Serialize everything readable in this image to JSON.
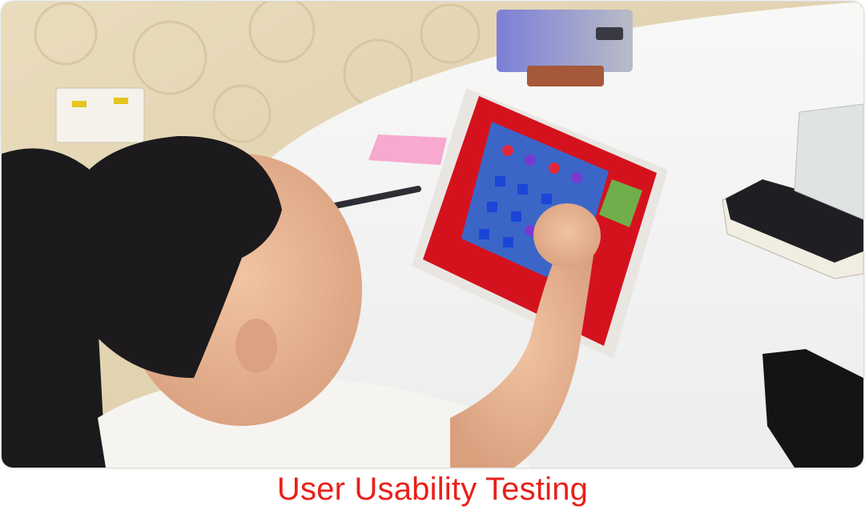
{
  "caption": {
    "text": "User Usability Testing",
    "color": "#e8201a"
  },
  "photo": {
    "icons": [
      "child-figure",
      "tablet",
      "smartphone",
      "pen",
      "sticky-note",
      "wall-socket",
      "eraser",
      "desk"
    ],
    "colors": {
      "wall": "#e5d6b4",
      "desk": "#f4f4f2",
      "tablet_case": "#d4121e",
      "game_board": "#3b66c8",
      "hair": "#1c1a1c",
      "skin": "#e9b895",
      "shirt": "#f6f4f0"
    }
  }
}
